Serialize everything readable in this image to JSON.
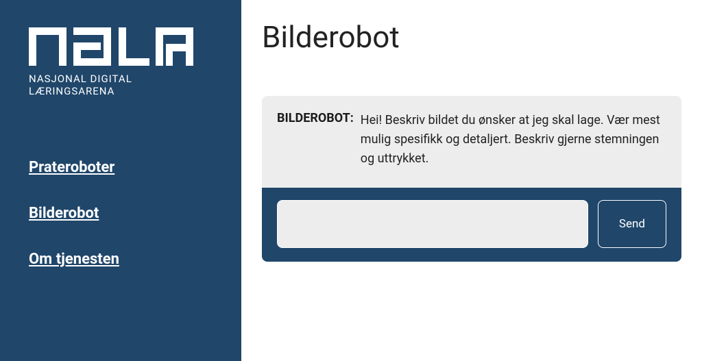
{
  "logo": {
    "subtitle": "NASJONAL DIGITAL LÆRINGSARENA"
  },
  "sidebar": {
    "items": [
      {
        "label": "Prateroboter"
      },
      {
        "label": "Bilderobot"
      },
      {
        "label": "Om tjenesten"
      }
    ]
  },
  "page": {
    "title": "Bilderobot"
  },
  "chat": {
    "sender_label": "BILDEROBOT:",
    "message": "Hei! Beskriv bildet du ønsker at jeg skal lage. Vær mest mulig spesifikk og detaljert. Beskriv gjerne stemningen og uttrykket.",
    "input_value": "",
    "send_label": "Send"
  }
}
